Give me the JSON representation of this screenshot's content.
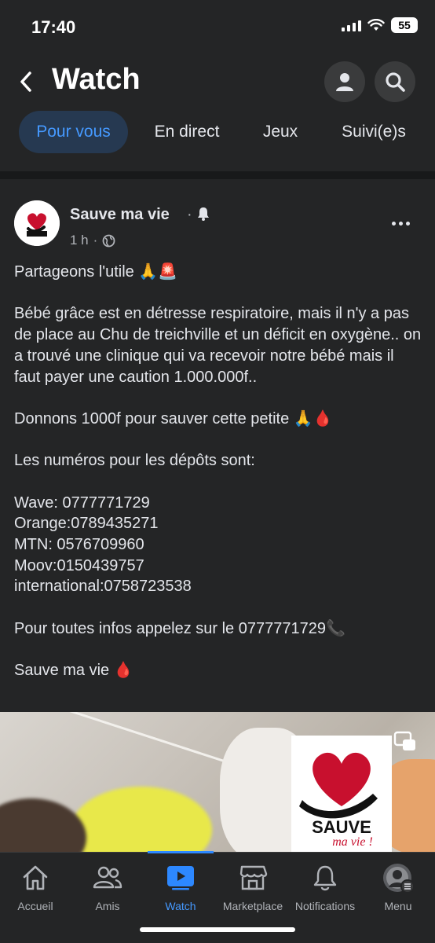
{
  "status_bar": {
    "time": "17:40",
    "battery": "55"
  },
  "header": {
    "title": "Watch"
  },
  "tabs": [
    {
      "label": "Pour vous",
      "active": true
    },
    {
      "label": "En direct",
      "active": false
    },
    {
      "label": "Jeux",
      "active": false
    },
    {
      "label": "Suivi(e)s",
      "active": false
    }
  ],
  "post": {
    "page_name": "Sauve ma vie",
    "separator": "·",
    "time_ago": "1 h",
    "meta_dot": "·",
    "lines": {
      "l1": "Partageons l'utile 🙏🚨",
      "l2": "Bébé grâce est en détresse respiratoire, mais il n'y a pas de place au Chu de treichville et un déficit en oxygène.. on a trouvé une clinique qui va recevoir notre bébé mais il faut payer une caution 1.000.000f..",
      "l3": "Donnons 1000f pour sauver cette petite 🙏🩸",
      "l4": "Les numéros pour les dépôts sont:",
      "l5": "Wave: 0777771729",
      "l6": "Orange:0789435271",
      "l7": "MTN: 0576709960",
      "l8": "Moov:0150439757",
      "l9": "international:0758723538",
      "l10": "Pour toutes infos appelez sur le 0777771729📞",
      "l11": "Sauve ma vie 🩸"
    },
    "video_logo_text": {
      "line1": "SAUVE",
      "line2": "ma vie !"
    }
  },
  "bottom_nav": [
    {
      "label": "Accueil",
      "icon": "home-icon"
    },
    {
      "label": "Amis",
      "icon": "friends-icon"
    },
    {
      "label": "Watch",
      "icon": "watch-icon",
      "active": true
    },
    {
      "label": "Marketplace",
      "icon": "marketplace-icon"
    },
    {
      "label": "Notifications",
      "icon": "bell-icon"
    },
    {
      "label": "Menu",
      "icon": "menu-avatar-icon"
    }
  ],
  "colors": {
    "accent": "#2d88ff",
    "background": "#242526",
    "active_tab_bg": "#263951"
  }
}
